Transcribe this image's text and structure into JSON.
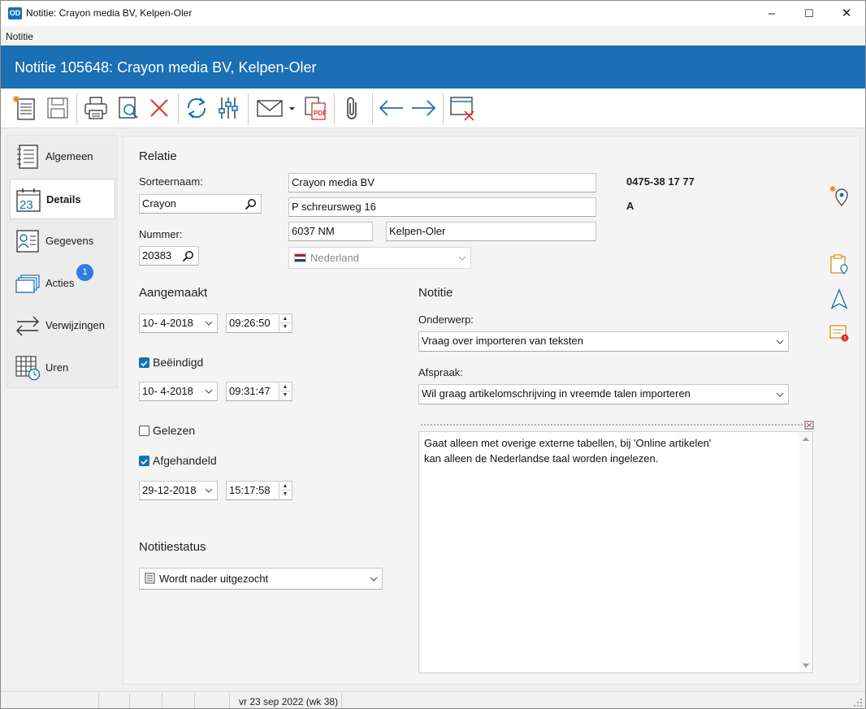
{
  "window": {
    "title": "Notitie: Crayon media BV, Kelpen-Oler",
    "app_icon": "OD",
    "minimize": "–",
    "maximize": "☐",
    "close": "✕"
  },
  "menu": {
    "item": "Notitie"
  },
  "header": {
    "title": "Notitie 105648: Crayon media BV, Kelpen-Oler"
  },
  "toolbar": {
    "icons": [
      "new-note-icon",
      "save-icon",
      "print-icon",
      "preview-icon",
      "delete-icon",
      "refresh-icon",
      "settings-sliders-icon",
      "mail-icon",
      "pdf-export-icon",
      "attachment-icon",
      "arrow-left-icon",
      "arrow-right-icon",
      "close-window-icon"
    ]
  },
  "sidebar": {
    "items": [
      {
        "label": "Algemeen",
        "icon": "document-icon"
      },
      {
        "label": "Details",
        "icon": "calendar-icon",
        "icon_text": "23",
        "active": true
      },
      {
        "label": "Gegevens",
        "icon": "contact-card-icon"
      },
      {
        "label": "Acties",
        "icon": "stack-icon",
        "badge": "1"
      },
      {
        "label": "Verwijzingen",
        "icon": "arrows-icon"
      },
      {
        "label": "Uren",
        "icon": "timesheet-icon"
      }
    ]
  },
  "relatie": {
    "section_title": "Relatie",
    "sorteernaam_label": "Sorteernaam:",
    "sorteernaam_value": "Crayon",
    "nummer_label": "Nummer:",
    "nummer_value": "20383",
    "name": "Crayon media BV",
    "street": "P schreursweg 16",
    "postcode": "6037 NM",
    "city": "Kelpen-Oler",
    "country": "Nederland",
    "phone": "0475-38 17 77",
    "code": "A"
  },
  "aangemaakt": {
    "title": "Aangemaakt",
    "date": "10-  4-2018",
    "time": "09:26:50"
  },
  "beeindigd": {
    "label": "Beëindigd",
    "checked": true,
    "date": "10-  4-2018",
    "time": "09:31:47"
  },
  "gelezen": {
    "label": "Gelezen",
    "checked": false
  },
  "afgehandeld": {
    "label": "Afgehandeld",
    "checked": true,
    "date": "29-12-2018",
    "time": "15:17:58"
  },
  "notitiestatus": {
    "title": "Notitiestatus",
    "value": "Wordt nader uitgezocht"
  },
  "notitie": {
    "title": "Notitie",
    "onderwerp_label": "Onderwerp:",
    "onderwerp_value": "Vraag over importeren van teksten",
    "afspraak_label": "Afspraak:",
    "afspraak_value": "Wil graag artikelomschrijving in vreemde talen importeren",
    "memo_line1": "Gaat alleen met overige externe tabellen, bij 'Online artikelen'",
    "memo_line2": "kan alleen de Nederlandse taal worden ingelezen."
  },
  "status_bar": {
    "date_text": "vr 23 sep 2022 (wk 38)"
  },
  "colors": {
    "accent": "#1a6fb5",
    "badge": "#2f7de1",
    "delete": "#d9342b"
  }
}
